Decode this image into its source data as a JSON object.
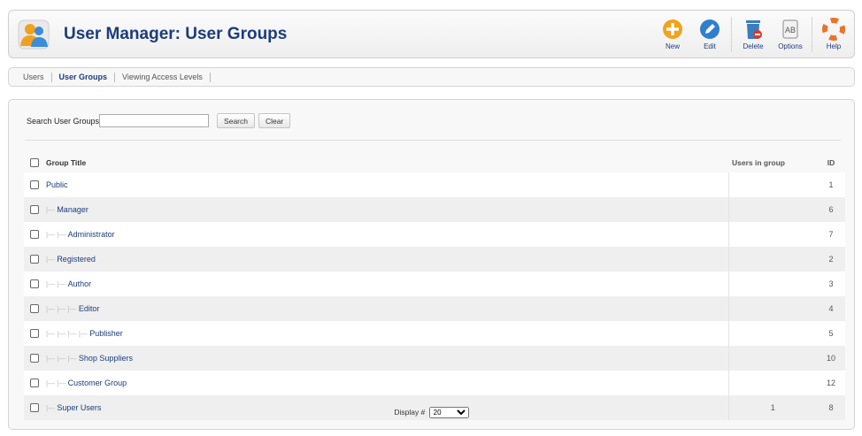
{
  "header": {
    "title": "User Manager: User Groups",
    "toolbar": [
      {
        "label": "New",
        "icon": "new-icon"
      },
      {
        "label": "Edit",
        "icon": "edit-icon"
      },
      {
        "label": "Delete",
        "icon": "delete-icon"
      },
      {
        "label": "Options",
        "icon": "options-icon"
      },
      {
        "label": "Help",
        "icon": "help-icon"
      }
    ]
  },
  "submenu": {
    "items": [
      "Users",
      "User Groups",
      "Viewing Access Levels"
    ],
    "active": "User Groups"
  },
  "filter": {
    "label": "Search User Groups",
    "value": "",
    "search_button": "Search",
    "clear_button": "Clear"
  },
  "table": {
    "columns": {
      "title": "Group Title",
      "users": "Users in group",
      "id": "ID"
    },
    "rows": [
      {
        "title": "Public",
        "level": 0,
        "users": "",
        "id": "1"
      },
      {
        "title": "Manager",
        "level": 1,
        "users": "",
        "id": "6"
      },
      {
        "title": "Administrator",
        "level": 2,
        "users": "",
        "id": "7"
      },
      {
        "title": "Registered",
        "level": 1,
        "users": "",
        "id": "2"
      },
      {
        "title": "Author",
        "level": 2,
        "users": "",
        "id": "3"
      },
      {
        "title": "Editor",
        "level": 3,
        "users": "",
        "id": "4"
      },
      {
        "title": "Publisher",
        "level": 4,
        "users": "",
        "id": "5"
      },
      {
        "title": "Shop Suppliers",
        "level": 3,
        "users": "",
        "id": "10"
      },
      {
        "title": "Customer Group",
        "level": 2,
        "users": "",
        "id": "12"
      },
      {
        "title": "Super Users",
        "level": 1,
        "users": "1",
        "id": "8"
      }
    ]
  },
  "footer": {
    "display_label": "Display #",
    "display_value": "20"
  },
  "colors": {
    "title_blue": "#1c3c7c",
    "new_orange": "#f3a21a",
    "edit_blue": "#2f7fd0",
    "delete_blue": "#3b7dbf",
    "help_orange": "#e7762a"
  }
}
